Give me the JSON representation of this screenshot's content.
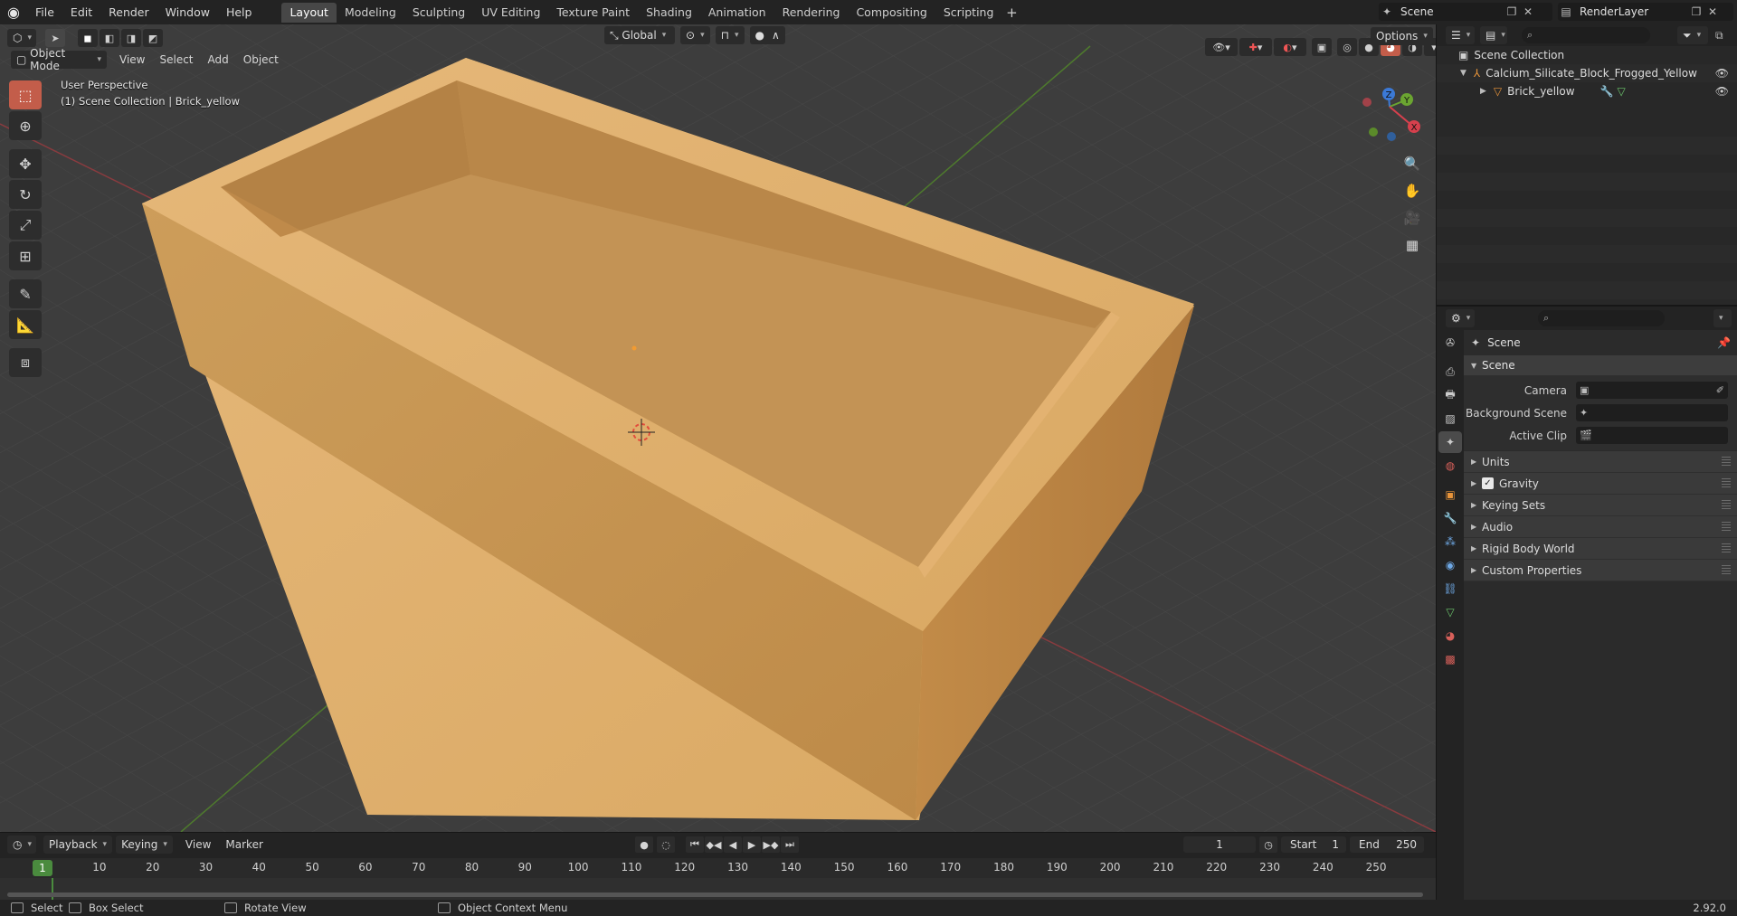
{
  "topbar": {
    "menus": [
      "File",
      "Edit",
      "Render",
      "Window",
      "Help"
    ],
    "workspaces": [
      "Layout",
      "Modeling",
      "Sculpting",
      "UV Editing",
      "Texture Paint",
      "Shading",
      "Animation",
      "Rendering",
      "Compositing",
      "Scripting"
    ],
    "active_workspace": "Layout",
    "add_tab": "+",
    "scene_name": "Scene",
    "view_layer": "RenderLayer"
  },
  "viewport": {
    "mode": "Object Mode",
    "menus": [
      "View",
      "Select",
      "Add",
      "Object"
    ],
    "orientation": "Global",
    "options_label": "Options",
    "info_line1": "User Perspective",
    "info_line2": "(1) Scene Collection | Brick_yellow",
    "axis_labels": {
      "x": "X",
      "y": "Y",
      "z": "Z"
    }
  },
  "timeline": {
    "menus": [
      "Playback",
      "Keying",
      "View",
      "Marker"
    ],
    "current_frame": "1",
    "start_label": "Start",
    "start_value": "1",
    "end_label": "End",
    "end_value": "250",
    "ruler_marks": [
      "1",
      "10",
      "20",
      "30",
      "40",
      "50",
      "60",
      "70",
      "80",
      "90",
      "100",
      "110",
      "120",
      "130",
      "140",
      "150",
      "160",
      "170",
      "180",
      "190",
      "200",
      "210",
      "220",
      "230",
      "240",
      "250"
    ]
  },
  "statusbar": {
    "select": "Select",
    "box_select": "Box Select",
    "rotate_view": "Rotate View",
    "context_menu": "Object Context Menu",
    "version": "2.92.0"
  },
  "outliner": {
    "root": "Scene Collection",
    "collection": "Calcium_Silicate_Block_Frogged_Yellow",
    "object": "Brick_yellow"
  },
  "properties": {
    "context": "Scene",
    "panel_title": "Scene",
    "fields": {
      "camera": "Camera",
      "background_scene": "Background Scene",
      "active_clip": "Active Clip"
    },
    "subpanels": [
      "Units",
      "Gravity",
      "Keying Sets",
      "Audio",
      "Rigid Body World",
      "Custom Properties"
    ]
  },
  "colors": {
    "accent": "#5680c2",
    "frame_green": "#4a8b3e",
    "brick": "#d9a660",
    "x_axis": "#d6404d",
    "y_axis": "#6ba531",
    "z_axis": "#3b79d6"
  }
}
